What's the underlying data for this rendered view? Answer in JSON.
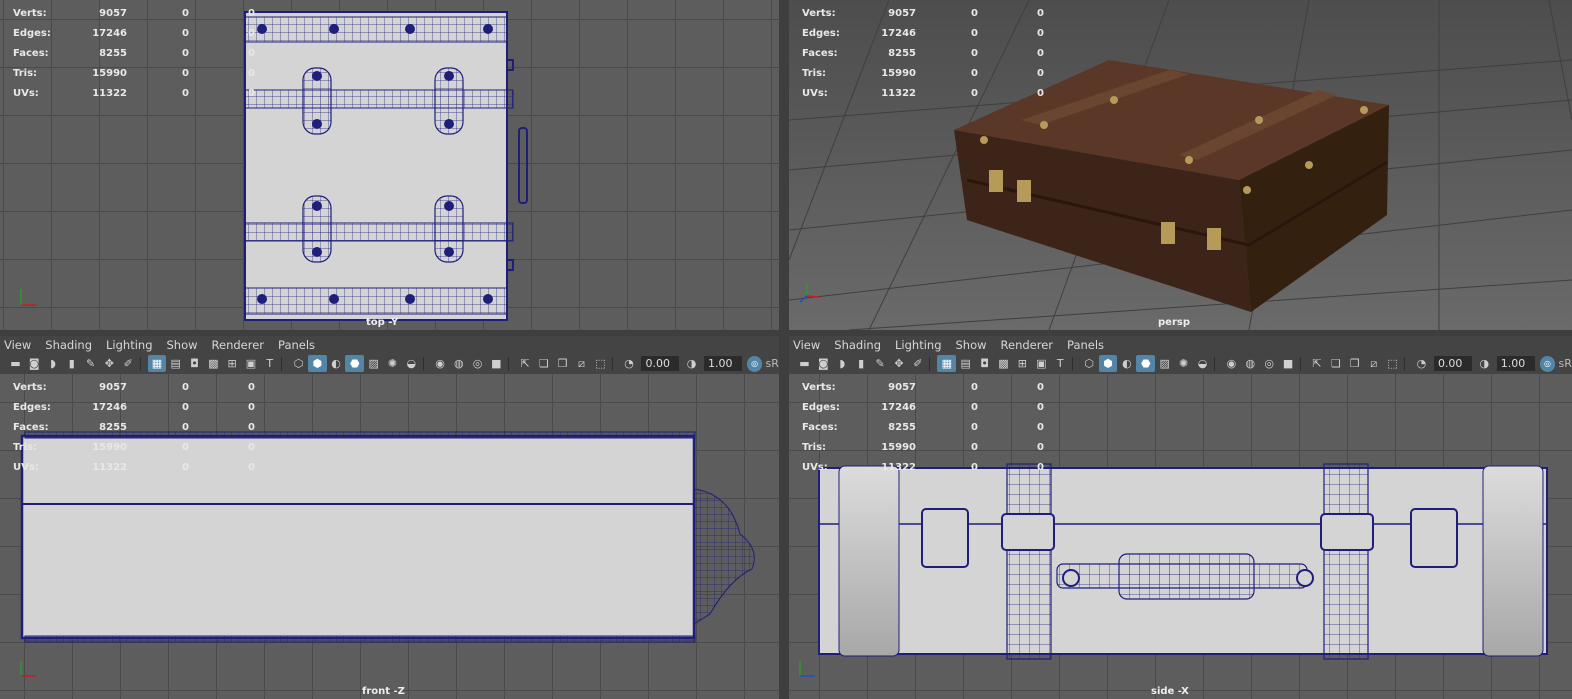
{
  "hud_stats": [
    {
      "label": "Verts:",
      "v1": "9057",
      "v2": "0",
      "v3": "0"
    },
    {
      "label": "Edges:",
      "v1": "17246",
      "v2": "0",
      "v3": "0"
    },
    {
      "label": "Faces:",
      "v1": "8255",
      "v2": "0",
      "v3": "0"
    },
    {
      "label": "Tris:",
      "v1": "15990",
      "v2": "0",
      "v3": "0"
    },
    {
      "label": "UVs:",
      "v1": "11322",
      "v2": "0",
      "v3": "0"
    }
  ],
  "cameras": {
    "top": "top -Y",
    "persp": "persp",
    "front": "front -Z",
    "side": "side -X"
  },
  "menu": [
    "View",
    "Shading",
    "Lighting",
    "Show",
    "Renderer",
    "Panels"
  ],
  "toolbar": {
    "exposure": "0.00",
    "gamma": "1.00",
    "color_space": "sR"
  },
  "colors": {
    "wire": "#1f1f7a",
    "model_fill": "#d4d4d4",
    "leather": "#4a2d1e",
    "selected_tool": "#5285a6"
  }
}
